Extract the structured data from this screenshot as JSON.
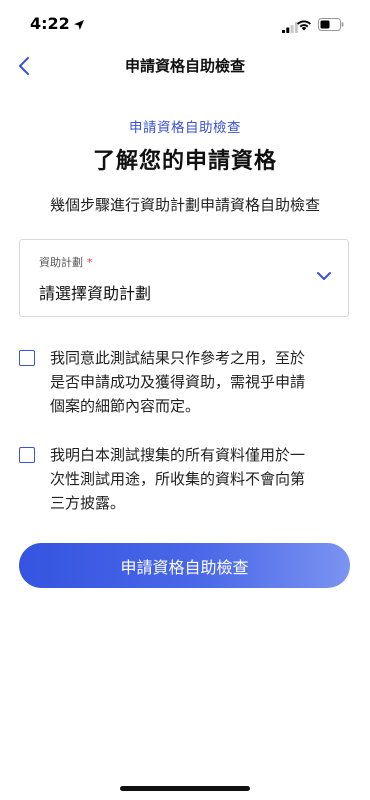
{
  "status_bar": {
    "time": "4:22"
  },
  "nav": {
    "title": "申請資格自助檢查"
  },
  "header": {
    "eyebrow": "申請資格自助檢查",
    "title": "了解您的申請資格",
    "subtitle": "幾個步驟進行資助計劃申請資格自助檢查"
  },
  "select": {
    "label": "資助計劃",
    "required_mark": "*",
    "value": "請選擇資助計劃"
  },
  "consents": [
    {
      "lines": [
        "我同意此測試結果只作參考之用，至於",
        "是否申請成功及獲得資助，需視乎申請",
        "個案的細節內容而定。"
      ],
      "checked": false
    },
    {
      "lines": [
        "我明白本測試搜集的所有資料僅用於一",
        "次性測試用途，所收集的資料不會向第",
        "三方披露。"
      ],
      "checked": false
    }
  ],
  "button": {
    "label": "申請資格自助檢查"
  },
  "colors": {
    "accent": "#3a51d8",
    "required": "#e53935"
  }
}
